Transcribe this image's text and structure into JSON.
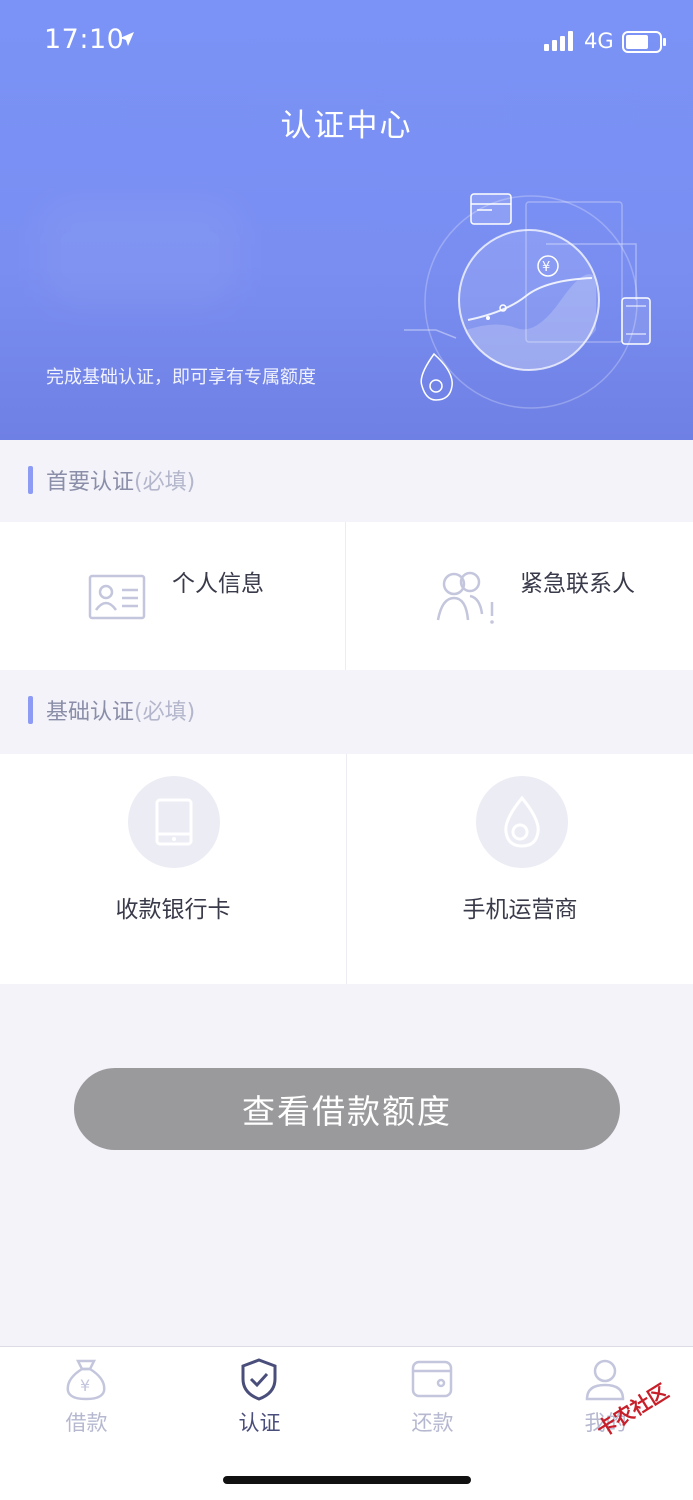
{
  "status": {
    "time": "17:10",
    "network": "4G"
  },
  "header": {
    "title": "认证中心",
    "subtitle": "完成基础认证，即可享有专属额度"
  },
  "primary_section": {
    "title": "首要认证",
    "note": "(必填)",
    "items": [
      {
        "label": "个人信息",
        "icon": "id-card-icon"
      },
      {
        "label": "紧急联系人",
        "icon": "contacts-icon"
      }
    ]
  },
  "basic_section": {
    "title": "基础认证",
    "note": "(必填)",
    "items": [
      {
        "label": "收款银行卡",
        "icon": "phone-card-icon"
      },
      {
        "label": "手机运营商",
        "icon": "carrier-drop-icon"
      }
    ]
  },
  "cta": {
    "label": "查看借款额度"
  },
  "tabbar": {
    "items": [
      {
        "label": "借款",
        "icon": "money-bag-icon",
        "active": false
      },
      {
        "label": "认证",
        "icon": "shield-check-icon",
        "active": true
      },
      {
        "label": "还款",
        "icon": "wallet-icon",
        "active": false
      },
      {
        "label": "我的",
        "icon": "user-icon",
        "active": false
      }
    ]
  },
  "watermark": "卡农社区",
  "colors": {
    "header_gradient_top": "#7b93f6",
    "header_gradient_bottom": "#6f80e4",
    "accent_bar": "#8d9bf5",
    "cta_background": "#9a9a9c",
    "tab_active": "#4a4e7a",
    "tab_inactive": "#b6b8d0"
  }
}
